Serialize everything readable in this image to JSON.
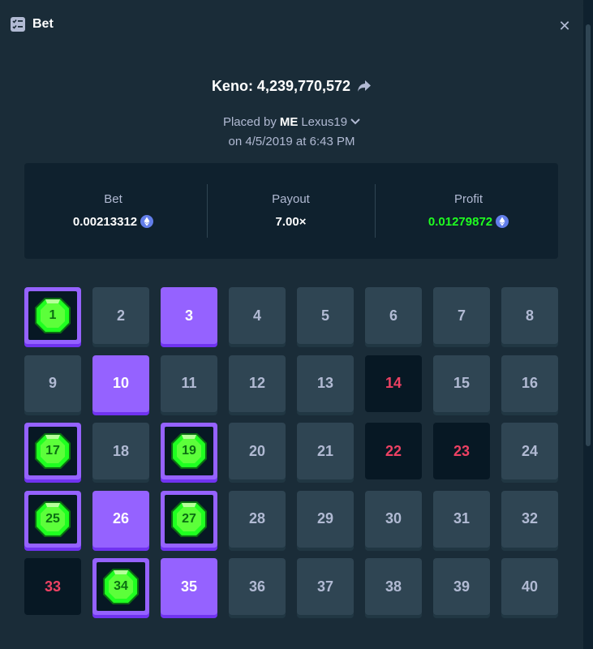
{
  "modal": {
    "title": "Bet",
    "icon": "bet-slip-icon",
    "close_icon": "close-icon"
  },
  "game": {
    "name": "Keno: 4,239,770,572",
    "share_icon": "share-arrow-icon"
  },
  "placed": {
    "prefix": "Placed by",
    "vip": "ME",
    "user": "Lexus19",
    "date": "on 4/5/2019 at 6:43 PM"
  },
  "stats": {
    "bet_label": "Bet",
    "bet_value": "0.00213312",
    "payout_label": "Payout",
    "payout_value": "7.00×",
    "profit_label": "Profit",
    "profit_value": "0.01279872",
    "currency_icon": "eth-icon"
  },
  "colors": {
    "background": "#0f212e",
    "panel": "#1a2c38",
    "tile": "#2f4553",
    "selected": "#9562ff",
    "miss_text": "#ed4163",
    "profit": "#1fff20",
    "gem": "#1fff20"
  },
  "tiles": [
    {
      "n": "1",
      "s": "hit"
    },
    {
      "n": "2",
      "s": "normal"
    },
    {
      "n": "3",
      "s": "selected"
    },
    {
      "n": "4",
      "s": "normal"
    },
    {
      "n": "5",
      "s": "normal"
    },
    {
      "n": "6",
      "s": "normal"
    },
    {
      "n": "7",
      "s": "normal"
    },
    {
      "n": "8",
      "s": "normal"
    },
    {
      "n": "9",
      "s": "normal"
    },
    {
      "n": "10",
      "s": "selected"
    },
    {
      "n": "11",
      "s": "normal"
    },
    {
      "n": "12",
      "s": "normal"
    },
    {
      "n": "13",
      "s": "normal"
    },
    {
      "n": "14",
      "s": "miss"
    },
    {
      "n": "15",
      "s": "normal"
    },
    {
      "n": "16",
      "s": "normal"
    },
    {
      "n": "17",
      "s": "hit"
    },
    {
      "n": "18",
      "s": "normal"
    },
    {
      "n": "19",
      "s": "hit"
    },
    {
      "n": "20",
      "s": "normal"
    },
    {
      "n": "21",
      "s": "normal"
    },
    {
      "n": "22",
      "s": "miss"
    },
    {
      "n": "23",
      "s": "miss"
    },
    {
      "n": "24",
      "s": "normal"
    },
    {
      "n": "25",
      "s": "hit"
    },
    {
      "n": "26",
      "s": "selected"
    },
    {
      "n": "27",
      "s": "hit"
    },
    {
      "n": "28",
      "s": "normal"
    },
    {
      "n": "29",
      "s": "normal"
    },
    {
      "n": "30",
      "s": "normal"
    },
    {
      "n": "31",
      "s": "normal"
    },
    {
      "n": "32",
      "s": "normal"
    },
    {
      "n": "33",
      "s": "miss"
    },
    {
      "n": "34",
      "s": "hit"
    },
    {
      "n": "35",
      "s": "selected"
    },
    {
      "n": "36",
      "s": "normal"
    },
    {
      "n": "37",
      "s": "normal"
    },
    {
      "n": "38",
      "s": "normal"
    },
    {
      "n": "39",
      "s": "normal"
    },
    {
      "n": "40",
      "s": "normal"
    }
  ]
}
